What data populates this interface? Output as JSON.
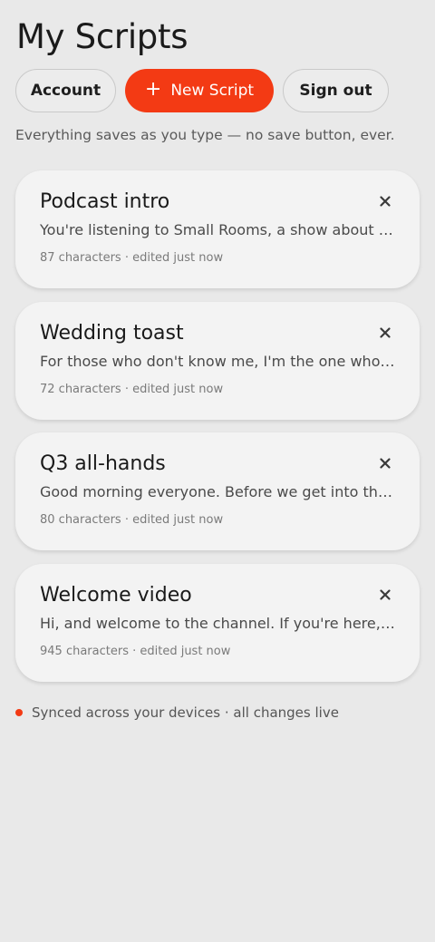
{
  "header": {
    "title": "My Scripts"
  },
  "actions": {
    "account_label": "Account",
    "new_script_label": "New Script",
    "sign_out_label": "Sign out"
  },
  "tagline": "Everything saves as you type — no save button, ever.",
  "scripts": [
    {
      "title": "Podcast intro",
      "preview": "You're listening to Small Rooms, a show about the people who build them.",
      "meta": "87 characters · edited just now"
    },
    {
      "title": "Wedding toast",
      "preview": "For those who don't know me, I'm the one who introduced them.",
      "meta": "72 characters · edited just now"
    },
    {
      "title": "Q3 all-hands",
      "preview": "Good morning everyone. Before we get into the numbers today...",
      "meta": "80 characters · edited just now"
    },
    {
      "title": "Welcome video",
      "preview": "Hi, and welcome to the channel. If you're here, you probably...",
      "meta": "945 characters · edited just now"
    }
  ],
  "status": {
    "sync_text": "Synced across your devices · all changes live"
  },
  "colors": {
    "accent": "#f33a14",
    "background": "#e9e9e9",
    "card": "#f3f3f3"
  },
  "icons": {
    "new_script": "plus-icon",
    "card_delete": "close-icon",
    "sync": "status-dot-icon"
  }
}
